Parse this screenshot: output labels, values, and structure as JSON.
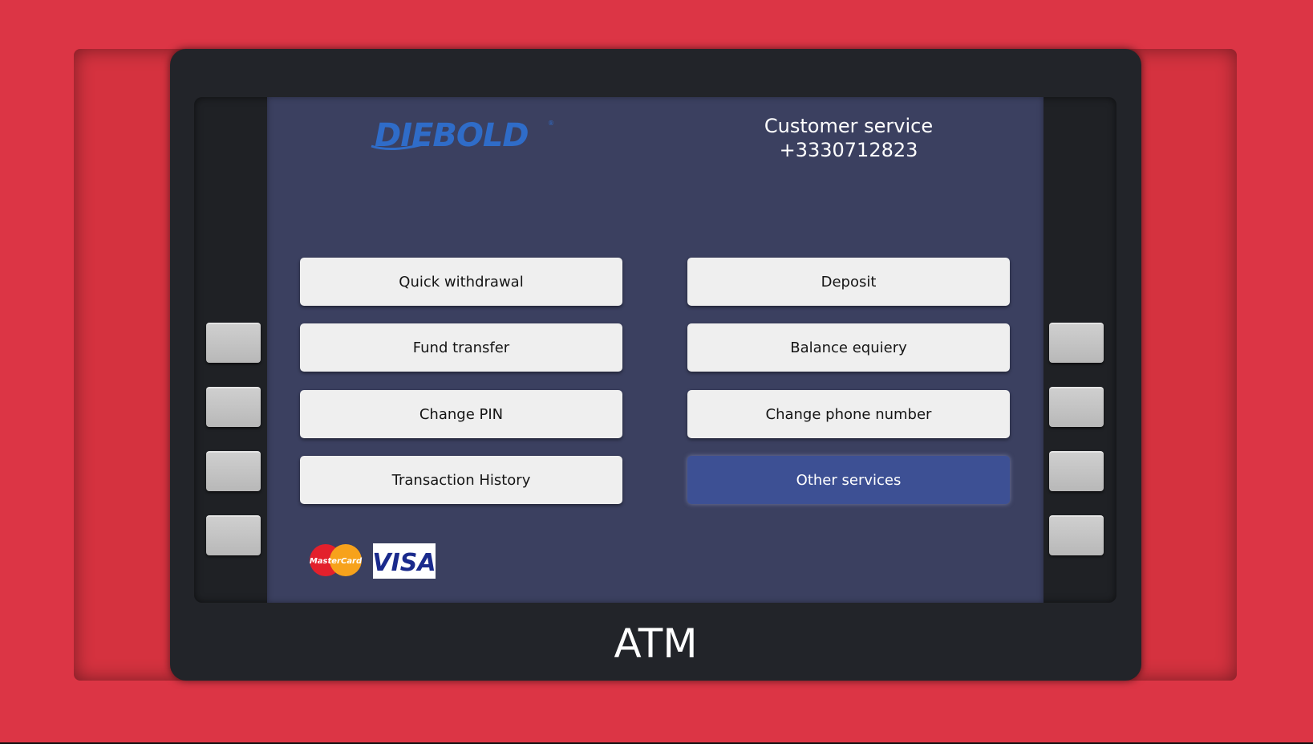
{
  "brand": {
    "logo_text": "DIEBOLD"
  },
  "customer_service": {
    "title": "Customer service",
    "phone": "+3330712823"
  },
  "menu": {
    "left": [
      {
        "label": "Quick withdrawal"
      },
      {
        "label": "Fund transfer"
      },
      {
        "label": "Change PIN"
      },
      {
        "label": "Transaction History"
      }
    ],
    "right": [
      {
        "label": "Deposit"
      },
      {
        "label": "Balance equiery"
      },
      {
        "label": "Change phone number"
      },
      {
        "label": "Other services",
        "selected": true
      }
    ]
  },
  "card_logos": {
    "mastercard": "MasterCard",
    "visa": "VISA"
  },
  "machine_label": "ATM",
  "colors": {
    "background": "#dc3545",
    "bezel": "#222429",
    "screen": "#3b4060",
    "button": "#efefef",
    "selected_button": "#3d5094",
    "logo_blue": "#2f6cc8"
  }
}
